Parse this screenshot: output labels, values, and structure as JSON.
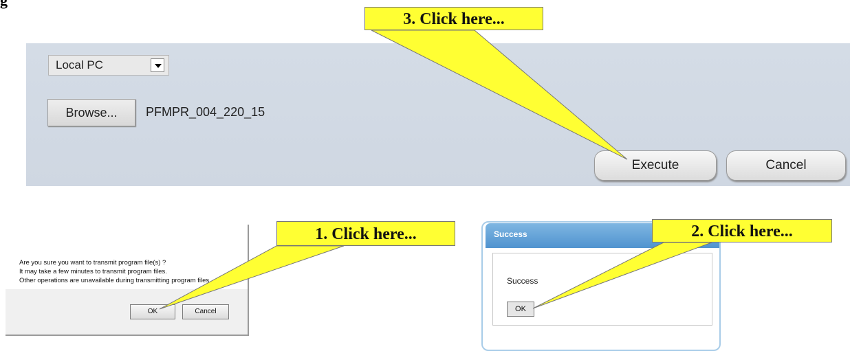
{
  "page": {
    "corner_label": "g"
  },
  "transfer_panel": {
    "source_select": {
      "value": "Local PC"
    },
    "browse_label": "Browse...",
    "filename": "PFMPR_004_220_15",
    "execute_label": "Execute",
    "cancel_label": "Cancel"
  },
  "confirm_dialog": {
    "lines": [
      "Are you sure you want to transmit program file(s) ?",
      "It may take a few minutes to transmit program files.",
      "Other operations are unavailable during transmitting program files."
    ],
    "ok_label": "OK",
    "cancel_label": "Cancel"
  },
  "success_dialog": {
    "title": "Success",
    "message": "Success",
    "ok_label": "OK"
  },
  "callouts": {
    "step1": "1. Click here...",
    "step2": "2. Click here...",
    "step3": "3. Click here..."
  },
  "colors": {
    "callout_yellow": "#ffff33",
    "panel_bg": "#d4dce6",
    "title_blue": "#4f93cf"
  }
}
